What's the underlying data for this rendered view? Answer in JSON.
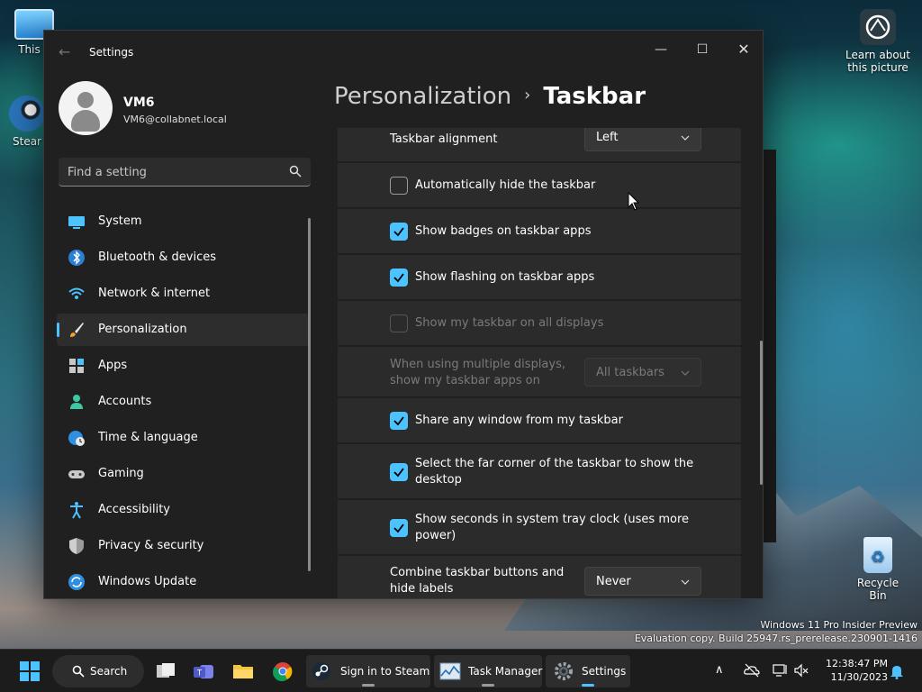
{
  "desktop": {
    "this_pc_label": "This P",
    "steam_label": "Stear",
    "learn_label_1": "Learn about",
    "learn_label_2": "this picture",
    "recycle_label": "Recycle Bin",
    "watermark_line1": "Windows 11 Pro Insider Preview",
    "watermark_line2": "Evaluation copy. Build 25947.rs_prerelease.230901-1416"
  },
  "window": {
    "title": "Settings",
    "back_icon": "arrow-left-icon",
    "minimize_icon": "minimize-icon",
    "maximize_icon": "maximize-icon",
    "close_icon": "close-icon"
  },
  "profile": {
    "name": "VM6",
    "email": "VM6@collabnet.local"
  },
  "search": {
    "placeholder": "Find a setting"
  },
  "nav": {
    "items": [
      {
        "label": "System",
        "icon": "monitor-icon"
      },
      {
        "label": "Bluetooth & devices",
        "icon": "bluetooth-icon"
      },
      {
        "label": "Network & internet",
        "icon": "wifi-icon"
      },
      {
        "label": "Personalization",
        "icon": "brush-icon",
        "active": true
      },
      {
        "label": "Apps",
        "icon": "apps-icon"
      },
      {
        "label": "Accounts",
        "icon": "person-icon"
      },
      {
        "label": "Time & language",
        "icon": "globe-clock-icon"
      },
      {
        "label": "Gaming",
        "icon": "gamepad-icon"
      },
      {
        "label": "Accessibility",
        "icon": "accessibility-icon"
      },
      {
        "label": "Privacy & security",
        "icon": "shield-icon"
      },
      {
        "label": "Windows Update",
        "icon": "refresh-icon"
      }
    ]
  },
  "header": {
    "parent": "Personalization",
    "separator": "›",
    "current": "Taskbar"
  },
  "settings": {
    "alignment_label": "Taskbar alignment",
    "alignment_value": "Left",
    "auto_hide_label": "Automatically hide the taskbar",
    "badges_label": "Show badges on taskbar apps",
    "flashing_label": "Show flashing on taskbar apps",
    "all_displays_label": "Show my taskbar on all displays",
    "multi_display_label_1": "When using multiple displays,",
    "multi_display_label_2": "show my taskbar apps on",
    "multi_display_value": "All taskbars",
    "share_window_label": "Share any window from my taskbar",
    "far_corner_label_1": "Select the far corner of the taskbar to show the",
    "far_corner_label_2": "desktop",
    "seconds_label_1": "Show seconds in system tray clock (uses more",
    "seconds_label_2": "power)",
    "combine_label_1": "Combine taskbar buttons and",
    "combine_label_2": "hide labels",
    "combine_value": "Never"
  },
  "taskbar": {
    "search_label": "Search",
    "steam_label": "Sign in to Steam",
    "task_manager_label": "Task Manager",
    "settings_label": "Settings",
    "time": "12:38:47 PM",
    "date": "11/30/2023"
  },
  "colors": {
    "accent": "#4cc2ff",
    "window_bg": "#202020",
    "card_bg": "#2b2b2b",
    "taskbar_bg": "#1c1c1c"
  }
}
